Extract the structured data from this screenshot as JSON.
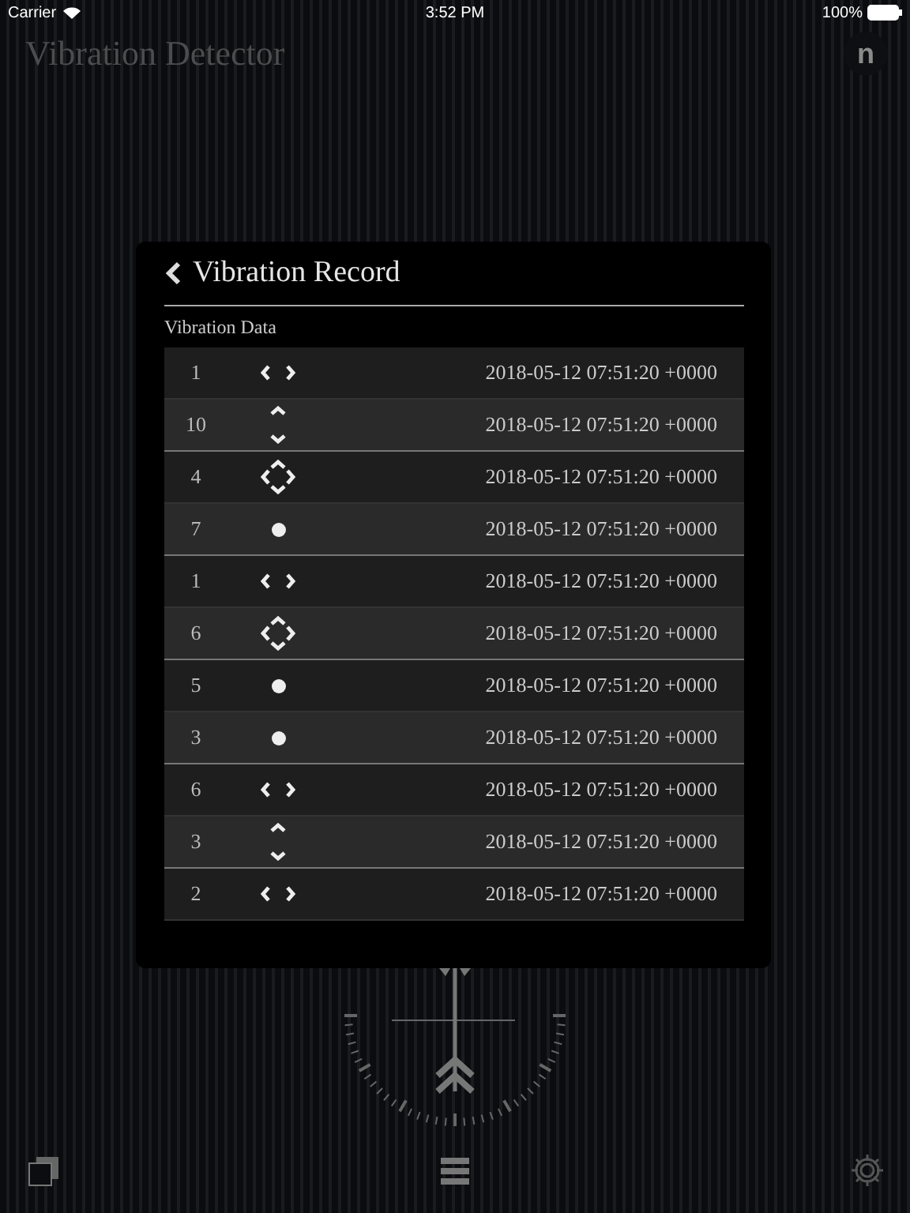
{
  "status_bar": {
    "carrier": "Carrier",
    "time": "3:52 PM",
    "battery": "100%"
  },
  "app_title": "Vibration Detector",
  "corner_button": "n",
  "panel": {
    "title": "Vibration Record",
    "section": "Vibration Data",
    "rows": [
      {
        "count": "1",
        "kind": "horizontal",
        "time": "2018-05-12 07:51:20 +0000"
      },
      {
        "count": "10",
        "kind": "vertical",
        "time": "2018-05-12 07:51:20 +0000"
      },
      {
        "count": "4",
        "kind": "both",
        "time": "2018-05-12 07:51:20 +0000"
      },
      {
        "count": "7",
        "kind": "dot",
        "time": "2018-05-12 07:51:20 +0000"
      },
      {
        "count": "1",
        "kind": "horizontal",
        "time": "2018-05-12 07:51:20 +0000"
      },
      {
        "count": "6",
        "kind": "both",
        "time": "2018-05-12 07:51:20 +0000"
      },
      {
        "count": "5",
        "kind": "dot",
        "time": "2018-05-12 07:51:20 +0000"
      },
      {
        "count": "3",
        "kind": "dot",
        "time": "2018-05-12 07:51:20 +0000"
      },
      {
        "count": "6",
        "kind": "horizontal",
        "time": "2018-05-12 07:51:20 +0000"
      },
      {
        "count": "3",
        "kind": "vertical",
        "time": "2018-05-12 07:51:20 +0000"
      },
      {
        "count": "2",
        "kind": "horizontal",
        "time": "2018-05-12 07:51:20 +0000"
      }
    ]
  }
}
